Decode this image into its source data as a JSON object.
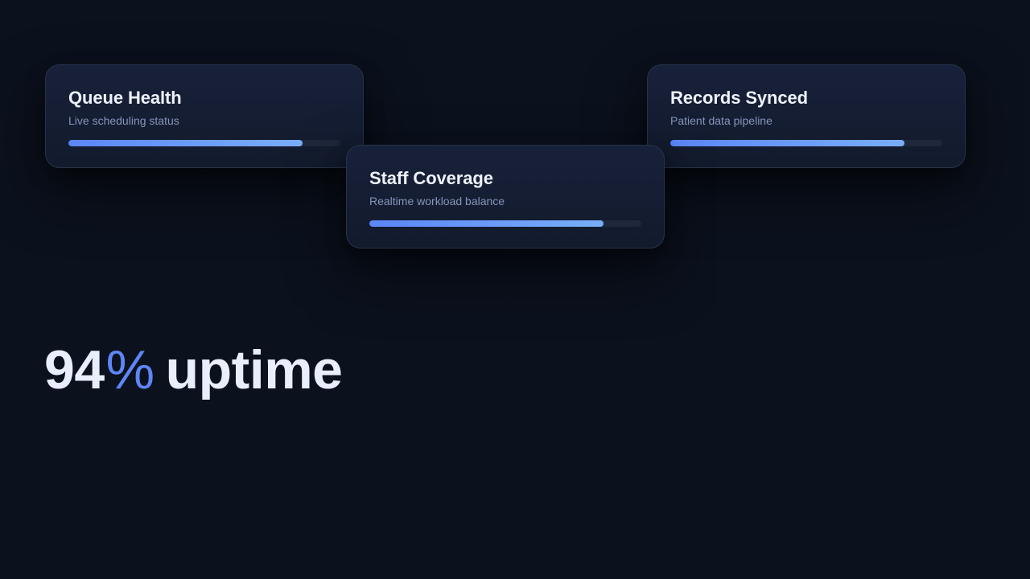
{
  "cards": [
    {
      "title": "Queue Health",
      "subtitle": "Live scheduling status",
      "progress_percent": 86
    },
    {
      "title": "Staff Coverage",
      "subtitle": "Realtime workload balance",
      "progress_percent": 86
    },
    {
      "title": "Records Synced",
      "subtitle": "Patient data pipeline",
      "progress_percent": 86
    }
  ],
  "headline": {
    "value": "94",
    "unit": "%",
    "label": "uptime"
  },
  "colors": {
    "background": "#0b111d",
    "accent": "#5d86f7",
    "progress_start": "#5b86f8",
    "progress_end": "#78aef9",
    "title_text": "#eef2fb",
    "subtitle_text": "#8695b8"
  }
}
